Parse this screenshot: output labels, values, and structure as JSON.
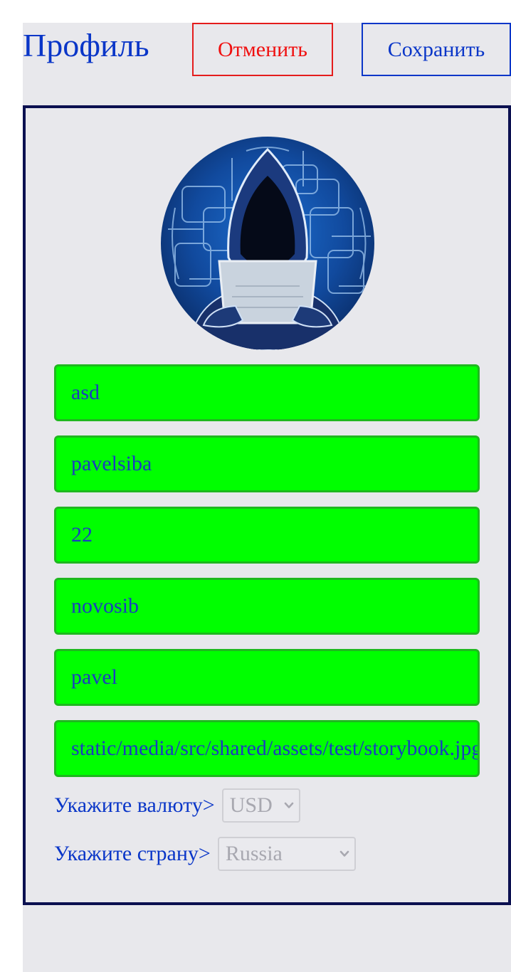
{
  "header": {
    "title": "Профиль",
    "cancel_label": "Отменить",
    "save_label": "Сохранить"
  },
  "profile": {
    "avatar_icon": "hacker-avatar-icon",
    "fields": [
      {
        "name": "first-name-field",
        "value": "asd"
      },
      {
        "name": "username-field",
        "value": "pavelsiba"
      },
      {
        "name": "age-field",
        "value": "22"
      },
      {
        "name": "city-field",
        "value": "novosib"
      },
      {
        "name": "last-name-field",
        "value": "pavel"
      },
      {
        "name": "avatar-url-field",
        "value": "static/media/src/shared/assets/test/storybook.jpg"
      }
    ],
    "currency": {
      "label": "Укажите валюту>",
      "selected": "USD"
    },
    "country": {
      "label": "Укажите страну>",
      "selected": "Russia"
    }
  },
  "colors": {
    "accent": "#0a36c8",
    "cancel": "#f01010",
    "field_bg": "#00ff00",
    "card_border": "#0b1050"
  }
}
